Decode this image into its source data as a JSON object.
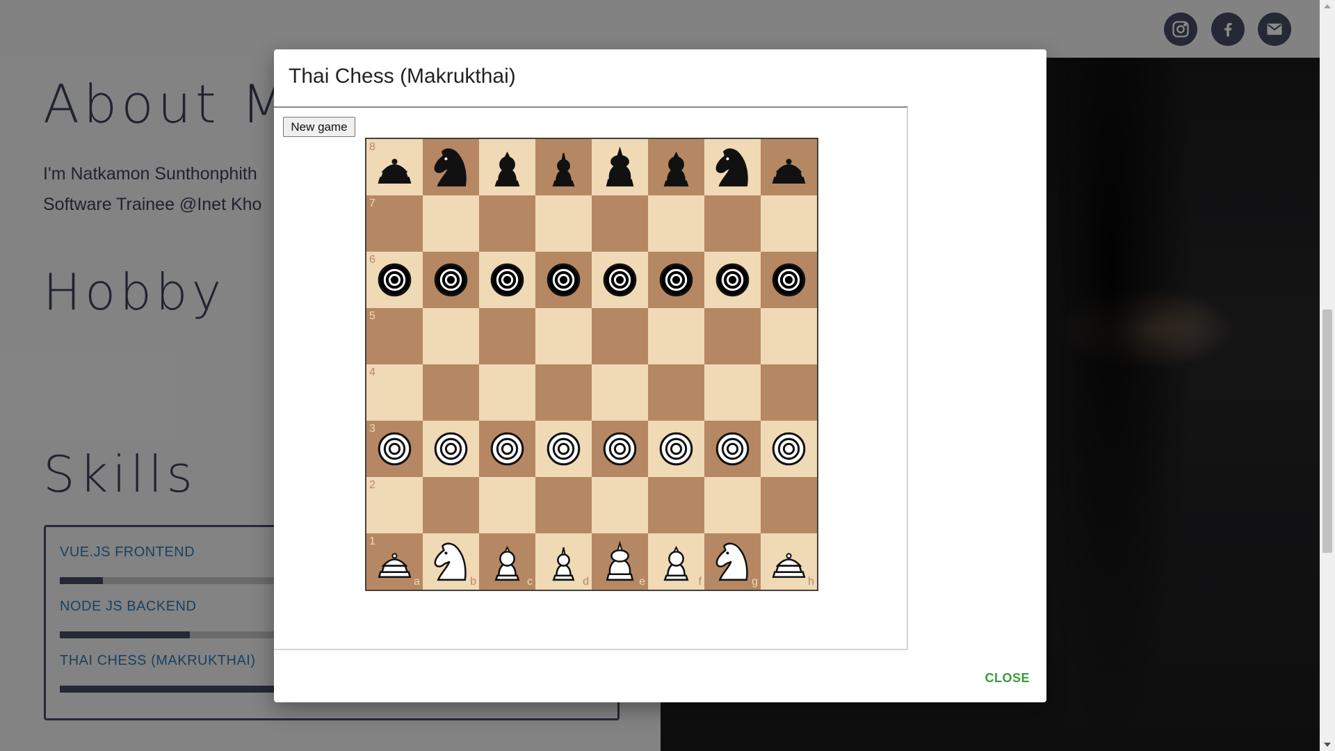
{
  "header": {
    "social_icons": [
      "instagram-icon",
      "facebook-icon",
      "mail-icon"
    ]
  },
  "page": {
    "about_title": "About Me",
    "about_line1": "I'm Natkamon Sunthonphith",
    "about_line2": "Software Trainee @Inet Kho",
    "hobby_title": "Hobby",
    "skills_title": "Skills",
    "skills": [
      {
        "label": "VUE.JS FRONTEND",
        "level": 0.08
      },
      {
        "label": "NODE JS BACKEND",
        "level": 0.24
      },
      {
        "label": "THAI CHESS (MAKRUKTHAI)",
        "level": 1.0
      }
    ]
  },
  "dialog": {
    "title": "Thai Chess (Makrukthai)",
    "new_game_label": "New game",
    "close_label": "CLOSE"
  },
  "board": {
    "files": [
      "a",
      "b",
      "c",
      "d",
      "e",
      "f",
      "g",
      "h"
    ],
    "ranks": [
      "8",
      "7",
      "6",
      "5",
      "4",
      "3",
      "2",
      "1"
    ],
    "rows": [
      [
        "bR",
        "bN",
        "bB",
        "bQ",
        "bK",
        "bB",
        "bN",
        "bR"
      ],
      [
        "",
        "",
        "",
        "",
        "",
        "",
        "",
        ""
      ],
      [
        "bP",
        "bP",
        "bP",
        "bP",
        "bP",
        "bP",
        "bP",
        "bP"
      ],
      [
        "",
        "",
        "",
        "",
        "",
        "",
        "",
        ""
      ],
      [
        "",
        "",
        "",
        "",
        "",
        "",
        "",
        ""
      ],
      [
        "wP",
        "wP",
        "wP",
        "wP",
        "wP",
        "wP",
        "wP",
        "wP"
      ],
      [
        "",
        "",
        "",
        "",
        "",
        "",
        "",
        ""
      ],
      [
        "wR",
        "wN",
        "wB",
        "wQ",
        "wK",
        "wB",
        "wN",
        "wR"
      ]
    ],
    "light_color": "#f0d9b5",
    "dark_color": "#b58863"
  }
}
